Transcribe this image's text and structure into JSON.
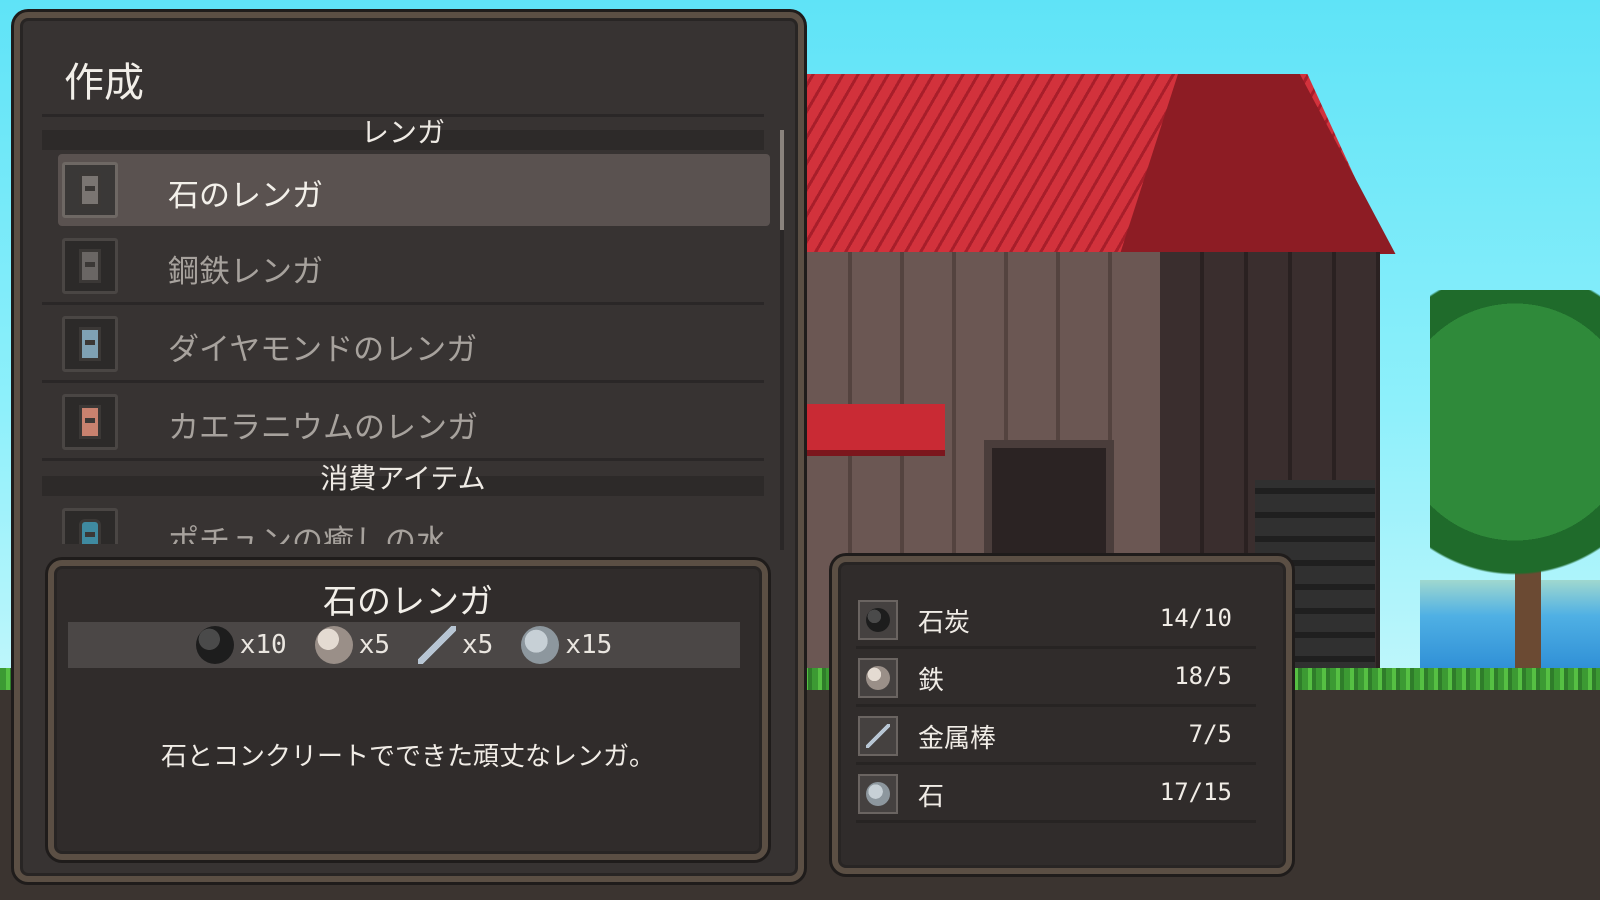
{
  "crafting": {
    "title": "作成",
    "sections": [
      {
        "name": "レンガ",
        "recipes": [
          {
            "label": "石のレンガ",
            "selected": true
          },
          {
            "label": "鋼鉄レンガ"
          },
          {
            "label": "ダイヤモンドのレンガ"
          },
          {
            "label": "カエラニウムのレンガ"
          }
        ]
      },
      {
        "name": "消費アイテム",
        "recipes": [
          {
            "label": "ポチュンの癒しの水"
          }
        ]
      }
    ]
  },
  "detail": {
    "title": "石のレンガ",
    "costs": [
      {
        "icon": "coal-icon",
        "qty": "x10"
      },
      {
        "icon": "iron-icon",
        "qty": "x5"
      },
      {
        "icon": "metal-rod-icon",
        "qty": "x5"
      },
      {
        "icon": "stone-icon",
        "qty": "x15"
      }
    ],
    "description": "石とコンクリートでできた頑丈なレンガ。"
  },
  "materials": [
    {
      "icon": "coal-icon",
      "name": "石炭",
      "count": "14/10"
    },
    {
      "icon": "iron-icon",
      "name": "鉄",
      "count": "18/5"
    },
    {
      "icon": "metal-rod-icon",
      "name": "金属棒",
      "count": "7/5"
    },
    {
      "icon": "stone-icon",
      "name": "石",
      "count": "17/15"
    }
  ]
}
